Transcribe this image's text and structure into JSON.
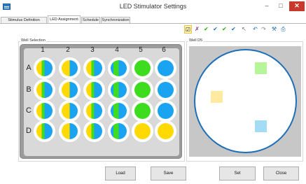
{
  "window": {
    "title": "LED Stimulator Settings",
    "minimize_glyph": "–",
    "maximize_glyph": "□",
    "close_glyph": "✕"
  },
  "tabs": [
    {
      "label": "Stimulus Definition"
    },
    {
      "label": "LED Assignment"
    },
    {
      "label": "Schedule"
    },
    {
      "label": "Synchronization"
    }
  ],
  "toolbar": {
    "buttons": [
      {
        "icon": "check-square-icon",
        "glyph": "☑"
      },
      {
        "icon": "x-icon",
        "glyph": "✗"
      },
      {
        "icon": "check-green-icon",
        "glyph": "✔"
      },
      {
        "icon": "check-blue-icon",
        "glyph": "✔"
      },
      {
        "icon": "check-bracket-icon",
        "glyph": "✔"
      },
      {
        "icon": "check-corner-icon",
        "glyph": "✔"
      },
      {
        "icon": "cursor-icon",
        "glyph": "↖"
      },
      {
        "icon": "undo-icon",
        "glyph": "↶"
      },
      {
        "icon": "redo-icon",
        "glyph": "↷"
      },
      {
        "icon": "paint-icon",
        "glyph": "⚒"
      },
      {
        "icon": "print-icon",
        "glyph": "⎙"
      }
    ]
  },
  "well_selection": {
    "label": "Well Selection",
    "columns": [
      "1",
      "2",
      "3",
      "4",
      "5",
      "6"
    ],
    "rows": [
      "A",
      "B",
      "C",
      "D"
    ],
    "grid": [
      [
        "ygb",
        "ybb",
        "ygb",
        "bgb",
        "green",
        "blue"
      ],
      [
        "ygb",
        "ybb",
        "ygb",
        "bgb",
        "green",
        "blue"
      ],
      [
        "ygb",
        "ybb",
        "ygb",
        "bgb",
        "green",
        "blue"
      ],
      [
        "ygb",
        "ybb",
        "ygb",
        "bgb",
        "yellow",
        "yellow"
      ]
    ]
  },
  "well_detail": {
    "label": "Well D5",
    "spots": [
      {
        "color": "#b6f59a"
      },
      {
        "color": "#ffeaa0"
      },
      {
        "color": "#a4dcf5"
      }
    ]
  },
  "colors": {
    "yellow": "#ffd900",
    "green": "#3ddc1e",
    "blue": "#19a3f0",
    "dark_blue": "#1f6fb8"
  },
  "buttons": {
    "load": "Load",
    "save": "Save",
    "set": "Set",
    "close": "Close"
  }
}
